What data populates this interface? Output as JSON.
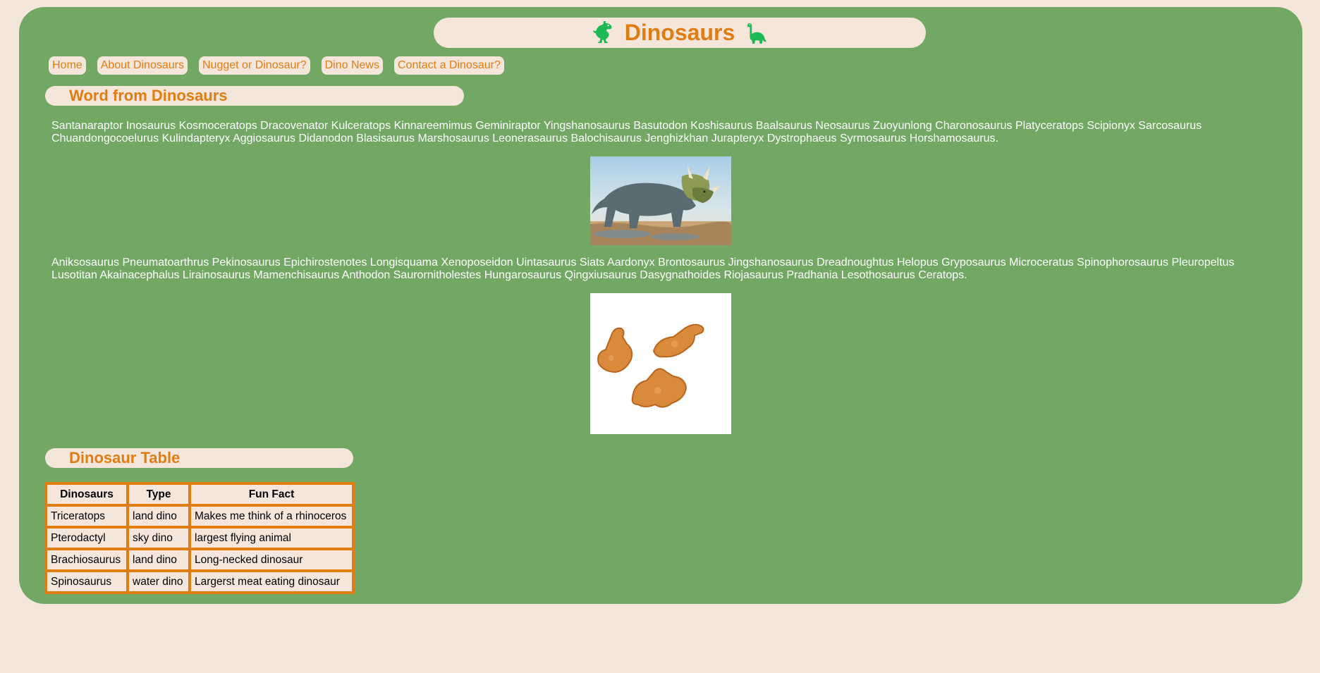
{
  "header": {
    "title": "Dinosaurs",
    "left_icon": "trex-icon",
    "right_icon": "sauropod-icon",
    "icon_color": "#1db954",
    "accent": "#e07d10"
  },
  "nav": {
    "items": [
      {
        "label": "Home"
      },
      {
        "label": "About Dinosaurs"
      },
      {
        "label": "Nugget or Dinosaur?"
      },
      {
        "label": "Dino News"
      },
      {
        "label": "Contact a Dinosaur?"
      }
    ]
  },
  "words_section": {
    "heading": "Word from Dinosaurs",
    "paragraph1": "Santanaraptor Inosaurus Kosmoceratops Dracovenator Kulceratops Kinnareemimus Geminiraptor Yingshanosaurus Basutodon Koshisaurus Baalsaurus Neosaurus Zuoyunlong Charonosaurus Platyceratops Scipionyx Sarcosaurus Chuandongocoelurus Kulindapteryx Aggiosaurus Didanodon Blasisaurus Marshosaurus Leonerasaurus Balochisaurus Jenghizkhan Jurapteryx Dystrophaeus Syrmosaurus Horshamosaurus.",
    "image1_icon": "ceratopsian-dinosaur-photo",
    "paragraph2": "Aniksosaurus Pneumatoarthrus Pekinosaurus Epichirostenotes Longisquama Xenoposeidon Uintasaurus Siats Aardonyx Brontosaurus Jingshanosaurus Dreadnoughtus Helopus Gryposaurus Microceratus Spinophorosaurus Pleuropeltus Lusotitan Akainacephalus Lirainosaurus Mamenchisaurus Anthodon Saurornitholestes Hungarosaurus Qingxiusaurus Dasygnathoides Riojasaurus Pradhania Lesothosaurus Ceratops.",
    "image2_icon": "dino-nuggets-photo"
  },
  "table_section": {
    "heading": "Dinosaur Table",
    "columns": [
      "Dinosaurs",
      "Type",
      "Fun Fact"
    ],
    "rows": [
      [
        "Triceratops",
        "land dino",
        "Makes me think of a rhinoceros"
      ],
      [
        "Pterodactyl",
        "sky dino",
        "largest flying animal"
      ],
      [
        "Brachiosaurus",
        "land dino",
        "Long-necked dinosaur"
      ],
      [
        "Spinosaurus",
        "water dino",
        "Largerst meat eating dinosaur"
      ]
    ]
  },
  "colors": {
    "page_bg": "#f5e6dc",
    "panel_bg": "#72a863",
    "accent": "#e07d10"
  }
}
